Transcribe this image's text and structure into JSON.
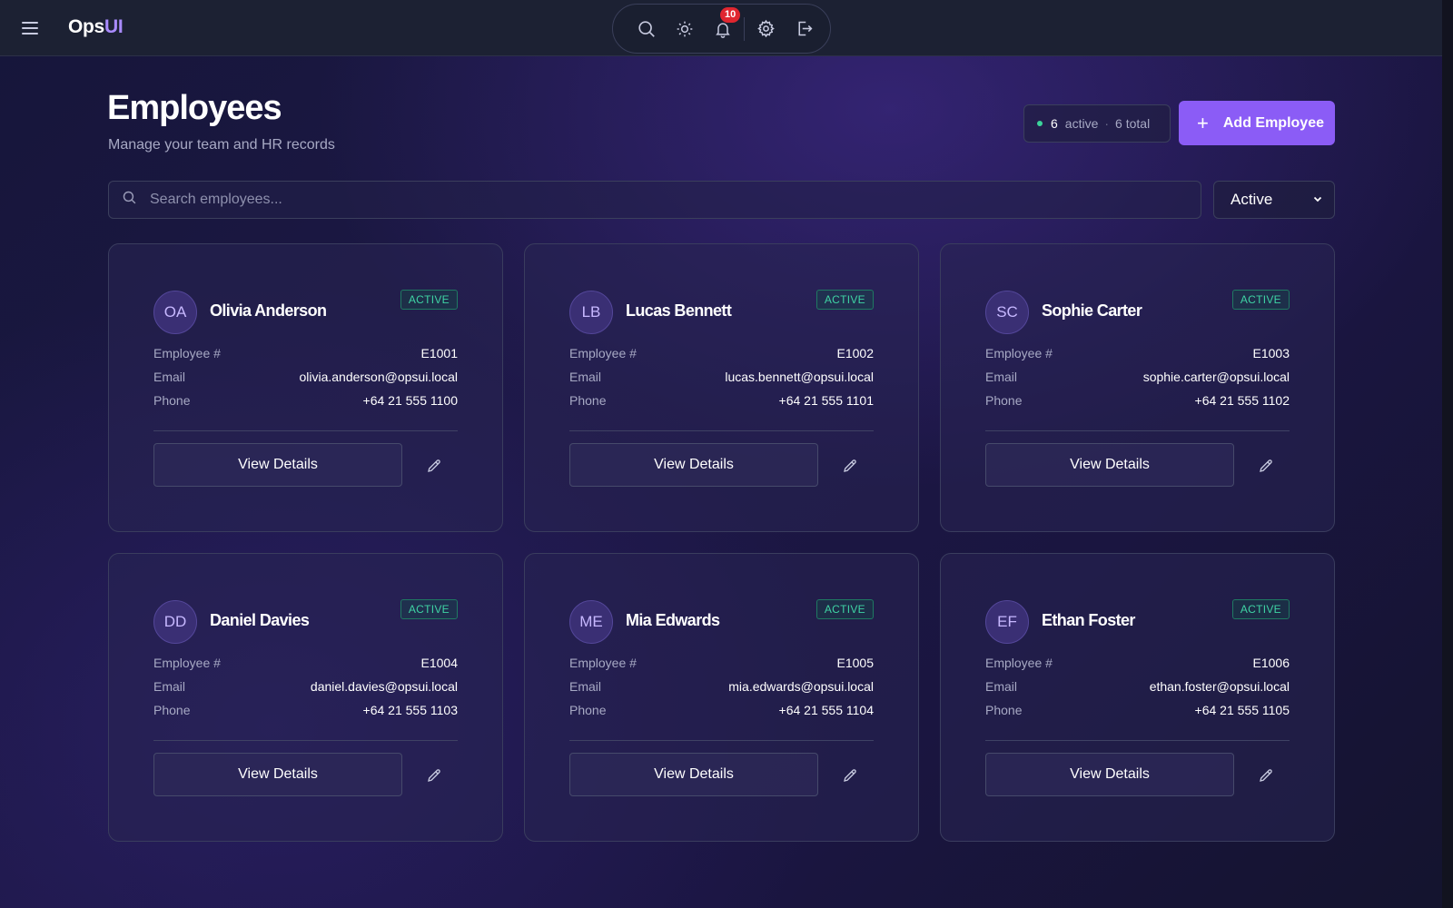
{
  "app": {
    "brand_prefix": "Ops",
    "brand_suffix": "UI",
    "notifications_count": "10"
  },
  "header": {
    "title": "Employees",
    "subtitle": "Manage your team and HR records",
    "active_count": "6",
    "active_label": "active",
    "total_label": "6 total",
    "add_button_label": "Add Employee"
  },
  "search": {
    "placeholder": "Search employees..."
  },
  "filter": {
    "selected": "Active"
  },
  "labels": {
    "employee_no": "Employee #",
    "email": "Email",
    "phone": "Phone",
    "view_details": "View Details"
  },
  "employees": [
    {
      "initials": "OA",
      "name": "Olivia Anderson",
      "status": "ACTIVE",
      "id": "E1001",
      "email": "olivia.anderson@opsui.local",
      "phone": "+64 21 555 1100"
    },
    {
      "initials": "LB",
      "name": "Lucas Bennett",
      "status": "ACTIVE",
      "id": "E1002",
      "email": "lucas.bennett@opsui.local",
      "phone": "+64 21 555 1101"
    },
    {
      "initials": "SC",
      "name": "Sophie Carter",
      "status": "ACTIVE",
      "id": "E1003",
      "email": "sophie.carter@opsui.local",
      "phone": "+64 21 555 1102"
    },
    {
      "initials": "DD",
      "name": "Daniel Davies",
      "status": "ACTIVE",
      "id": "E1004",
      "email": "daniel.davies@opsui.local",
      "phone": "+64 21 555 1103"
    },
    {
      "initials": "ME",
      "name": "Mia Edwards",
      "status": "ACTIVE",
      "id": "E1005",
      "email": "mia.edwards@opsui.local",
      "phone": "+64 21 555 1104"
    },
    {
      "initials": "EF",
      "name": "Ethan Foster",
      "status": "ACTIVE",
      "id": "E1006",
      "email": "ethan.foster@opsui.local",
      "phone": "+64 21 555 1105"
    }
  ],
  "colors": {
    "accent": "#8b5cf6",
    "brand_accent": "#a98bff",
    "status_active": "#3fd3a4",
    "notification": "#e0262f"
  },
  "icons": [
    "menu-icon",
    "search-icon",
    "sun-icon",
    "bell-icon",
    "gear-icon",
    "logout-icon",
    "plus-icon",
    "chevron-down-icon",
    "pencil-icon"
  ]
}
